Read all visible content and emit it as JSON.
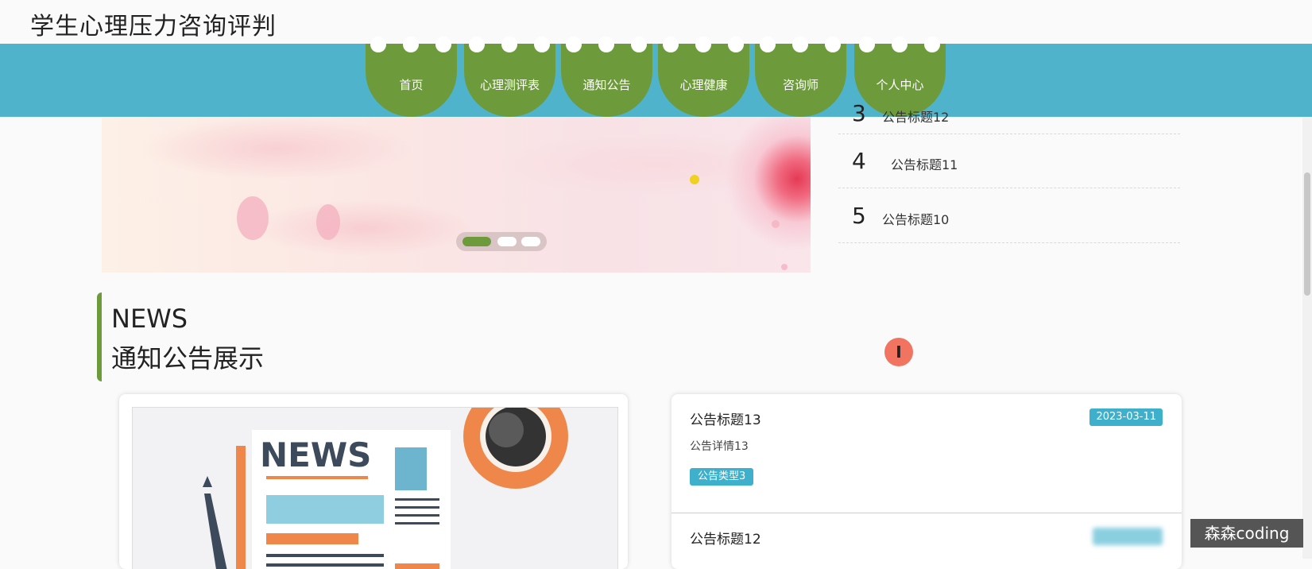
{
  "site": {
    "title": "学生心理压力咨询评判"
  },
  "nav": {
    "items": [
      {
        "label": "首页"
      },
      {
        "label": "心理测评表"
      },
      {
        "label": "通知公告"
      },
      {
        "label": "心理健康"
      },
      {
        "label": "咨询师"
      },
      {
        "label": "个人中心"
      }
    ]
  },
  "ranking": {
    "items": [
      {
        "num": "3",
        "title": "公告标题12"
      },
      {
        "num": "4",
        "title": "公告标题11"
      },
      {
        "num": "5",
        "title": "公告标题10"
      }
    ]
  },
  "news": {
    "heading_en": "NEWS",
    "heading_cn": "通知公告展示",
    "image_text": "NEWS"
  },
  "notices": [
    {
      "title": "公告标题13",
      "detail": "公告详情13",
      "date": "2023-03-11",
      "type": "公告类型3"
    },
    {
      "title": "公告标题12"
    }
  ],
  "cursor": {
    "glyph": "I"
  },
  "watermark": {
    "text": "森森coding"
  },
  "colors": {
    "nav_bar": "#4fb3cc",
    "nav_item": "#6d9b3c",
    "accent": "#6d9b3c",
    "badge": "#3eb0cc"
  }
}
